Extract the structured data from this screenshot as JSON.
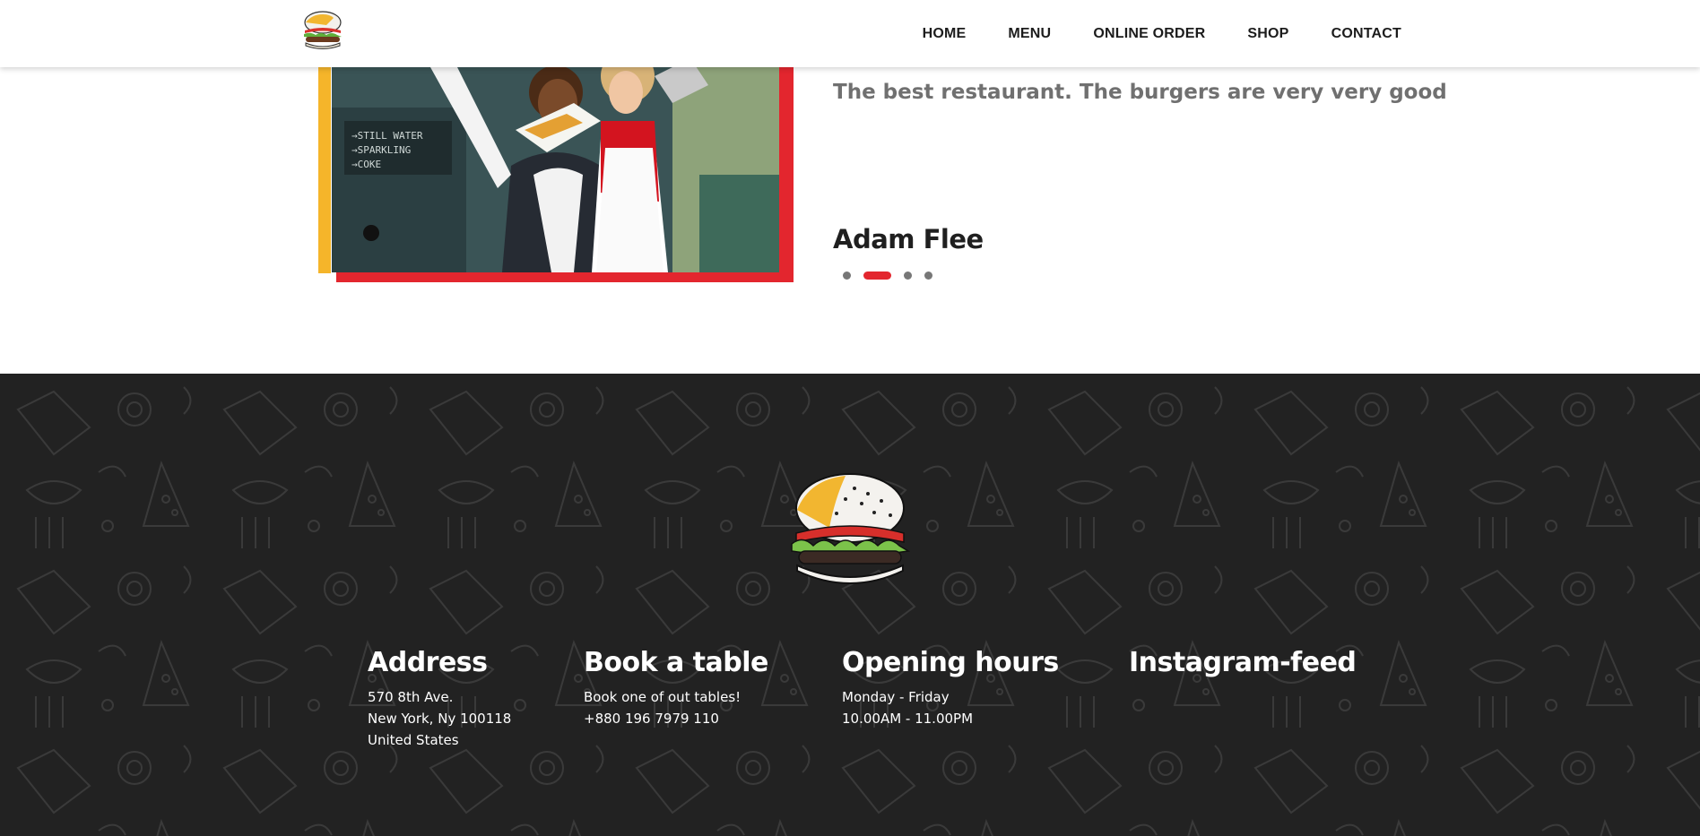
{
  "header": {
    "logo_icon": "burger-logo-icon",
    "nav": [
      {
        "label": "HOME"
      },
      {
        "label": "MENU"
      },
      {
        "label": "ONLINE ORDER"
      },
      {
        "label": "SHOP"
      },
      {
        "label": "CONTACT"
      }
    ]
  },
  "testimonial": {
    "quote": "The best restaurant. The burgers are very very good",
    "author": "Adam Flee",
    "slides_total": 4,
    "active_slide": 2,
    "photo_icon": "customers-photo",
    "colors": {
      "accent_red": "#e3262e",
      "accent_yellow": "#f5b52a",
      "quote_gray": "#707070"
    }
  },
  "footer": {
    "logo_icon": "burger-logo-icon",
    "background": "#222222",
    "address": {
      "title": "Address",
      "line1": "570 8th Ave.",
      "line2": "New York, Ny 100118",
      "line3": "United States"
    },
    "book": {
      "title": "Book a table",
      "line1": "Book one of out tables!",
      "line2": "+880 196 7979 110"
    },
    "hours": {
      "title": "Opening hours",
      "line1": "Monday - Friday",
      "line2": "10.00AM - 11.00PM"
    },
    "instagram": {
      "title": "Instagram-feed"
    }
  }
}
